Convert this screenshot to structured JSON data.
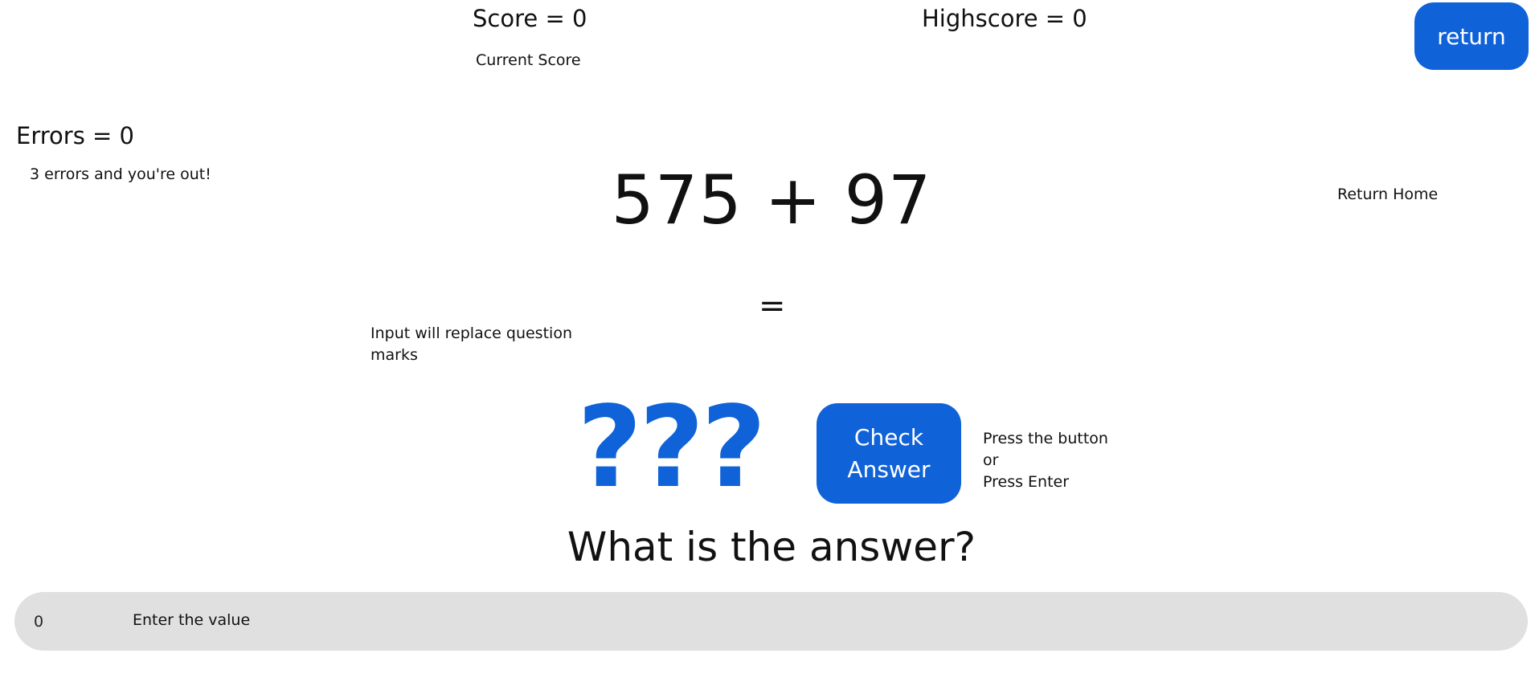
{
  "score": {
    "label": "Score = 0",
    "hint": "Current Score"
  },
  "highscore": {
    "label": "Highscore = 0"
  },
  "return": {
    "button_label": "return",
    "hint": "Return Home"
  },
  "errors": {
    "label": "Errors = 0",
    "hint": "3 errors and you're out!"
  },
  "question": {
    "expression": "575 + 97",
    "equals": "=",
    "answer_placeholder": "???",
    "input_hint": "Input will replace question marks"
  },
  "check": {
    "button_label": "Check Answer",
    "hint_line1": "Press the button",
    "hint_line2": "or",
    "hint_line3": "Press Enter"
  },
  "prompt": "What is the answer?",
  "answer_input": {
    "value": "0",
    "label": "Enter the value"
  },
  "colors": {
    "accent": "#0f62d8",
    "input_bar": "#e0e0e0"
  }
}
